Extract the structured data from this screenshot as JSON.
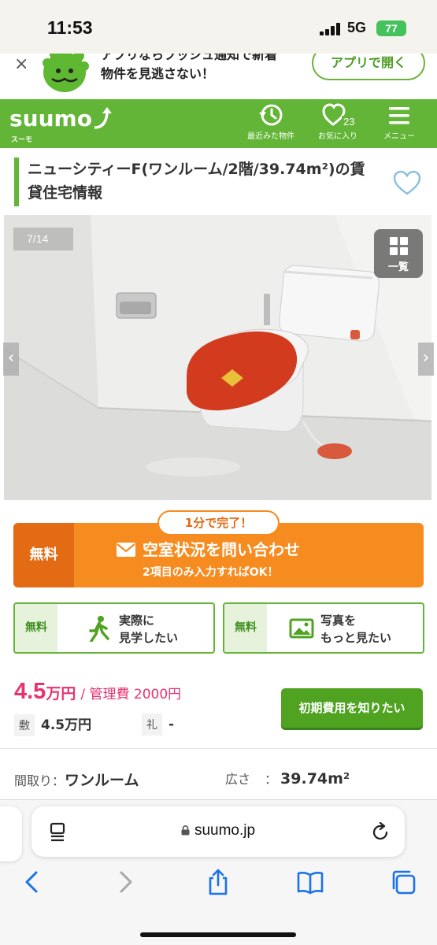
{
  "status_bar": {
    "time": "11:53",
    "network": "5G",
    "battery": "77"
  },
  "promo": {
    "line1": "アプリならプッシュ通知で新着",
    "line2": "物件を見逃さない！",
    "button": "アプリで開く",
    "close": "×"
  },
  "header": {
    "logo_sub": "スーモ",
    "history_label": "最近みた物件",
    "favorites_label": "お気に入り",
    "favorites_count": "23",
    "menu_label": "メニュー"
  },
  "title": "ニューシティーF(ワンルーム/2階/39.74m²)の賃貸住宅情報",
  "gallery": {
    "counter": "7/14",
    "grid_label": "一覧"
  },
  "inquiry": {
    "badge": "1分で完了！",
    "free": "無料",
    "main": "空室状況を問い合わせ",
    "sub": "2項目のみ入力すればOK！"
  },
  "visit_button": {
    "free": "無料",
    "line1": "実際に",
    "line2": "見学したい"
  },
  "photos_button": {
    "free": "無料",
    "line1": "写真を",
    "line2": "もっと見たい"
  },
  "price": {
    "rent": "4.5",
    "rent_unit": "万円",
    "management": "/ 管理費 2000円",
    "deposit_tag": "敷",
    "deposit": "4.5万円",
    "key_money_tag": "礼",
    "key_money": "-"
  },
  "initial_cost_button": "初期費用を知りたい",
  "specs": {
    "layout_key": "間取り：",
    "layout_val": "ワンルーム",
    "area_key": "広さ",
    "area_sep": "：",
    "area_val": "39.74m²"
  },
  "browser": {
    "url": "suumo.jp"
  },
  "colors": {
    "brand_green": "#62b536",
    "cta_orange": "#f68b1f",
    "price_pink": "#e8336f",
    "ios_blue": "#1a73e8"
  }
}
